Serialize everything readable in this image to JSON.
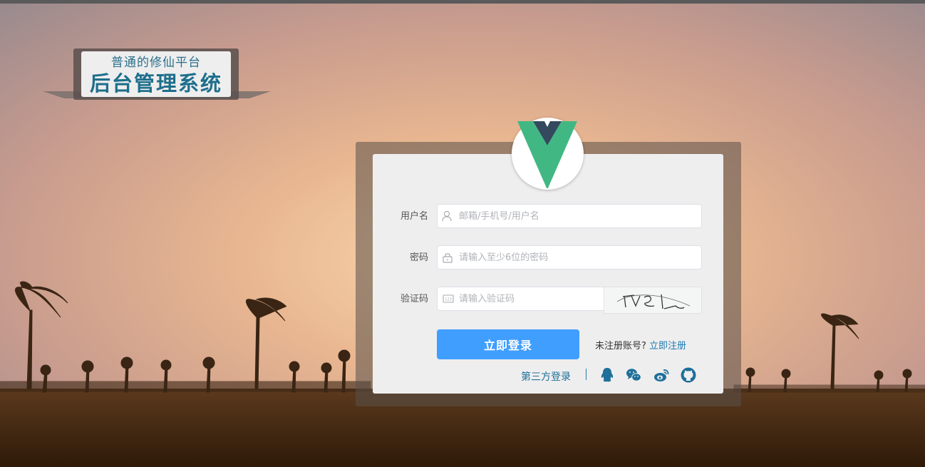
{
  "banner": {
    "subtitle": "普通的修仙平台",
    "title": "后台管理系统"
  },
  "logo": {
    "icon": "vue-logo-icon",
    "colors": {
      "outer": "#41b883",
      "inner": "#34495e"
    }
  },
  "form": {
    "username": {
      "label": "用户名",
      "placeholder": "邮箱/手机号/用户名",
      "value": ""
    },
    "password": {
      "label": "密码",
      "placeholder": "请输入至少6位的密码",
      "value": ""
    },
    "captcha": {
      "label": "验证码",
      "placeholder": "请输入验证码",
      "value": ""
    },
    "login_label": "立即登录",
    "register_prompt": "未注册账号?",
    "register_link": "立即注册",
    "third_party_label": "第三方登录",
    "social": [
      "qq-icon",
      "wechat-icon",
      "weibo-icon",
      "github-icon"
    ]
  },
  "colors": {
    "primary": "#409eff",
    "link": "#1f7ab0",
    "social": "#1e6f9a"
  }
}
